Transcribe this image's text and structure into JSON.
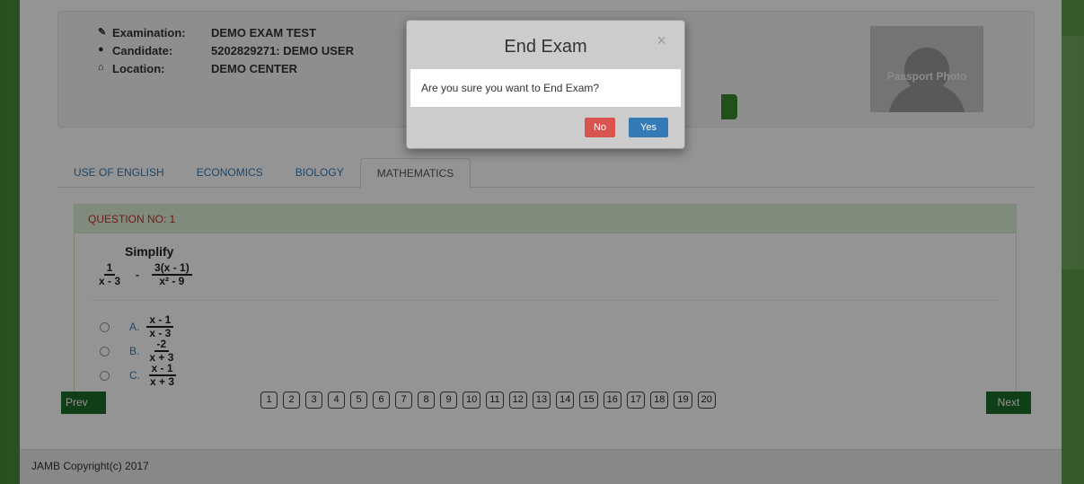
{
  "exam_info": {
    "examination_label": "Examination:",
    "examination_value": "DEMO EXAM TEST",
    "candidate_label": "Candidate:",
    "candidate_value": "5202829271: DEMO USER",
    "location_label": "Location:",
    "location_value": "DEMO CENTER"
  },
  "passport": {
    "text": "Passport Photo"
  },
  "tabs": [
    {
      "label": "USE OF ENGLISH"
    },
    {
      "label": "ECONOMICS"
    },
    {
      "label": "BIOLOGY"
    },
    {
      "label": "MATHEMATICS",
      "active": true
    }
  ],
  "question": {
    "header": "QUESTION NO: 1",
    "prompt": "Simplify",
    "expr": {
      "term1_num": "1",
      "term1_den": "x - 3",
      "operator": "-",
      "term2_num": "3(x - 1)",
      "term2_den": "x² - 9"
    },
    "options": [
      {
        "letter": "A.",
        "num": "x - 1",
        "den": "x - 3"
      },
      {
        "letter": "B.",
        "num": "-2",
        "den": "x + 3"
      },
      {
        "letter": "C.",
        "num": "x - 1",
        "den": "x + 3"
      }
    ]
  },
  "nav": {
    "prev": "Prev",
    "next": "Next",
    "pages": [
      "1",
      "2",
      "3",
      "4",
      "5",
      "6",
      "7",
      "8",
      "9",
      "10",
      "11",
      "12",
      "13",
      "14",
      "15",
      "16",
      "17",
      "18",
      "19",
      "20"
    ]
  },
  "footer": {
    "text": "JAMB Copyright(c) 2017"
  },
  "modal": {
    "title": "End Exam",
    "close": "×",
    "message": "Are you sure you want to End Exam?",
    "no": "No",
    "yes": "Yes"
  },
  "colors": {
    "nav_button": "#1d6b26",
    "no_button": "#d9534f",
    "yes_button": "#337ab7",
    "question_header_bg": "#dff0d8"
  }
}
